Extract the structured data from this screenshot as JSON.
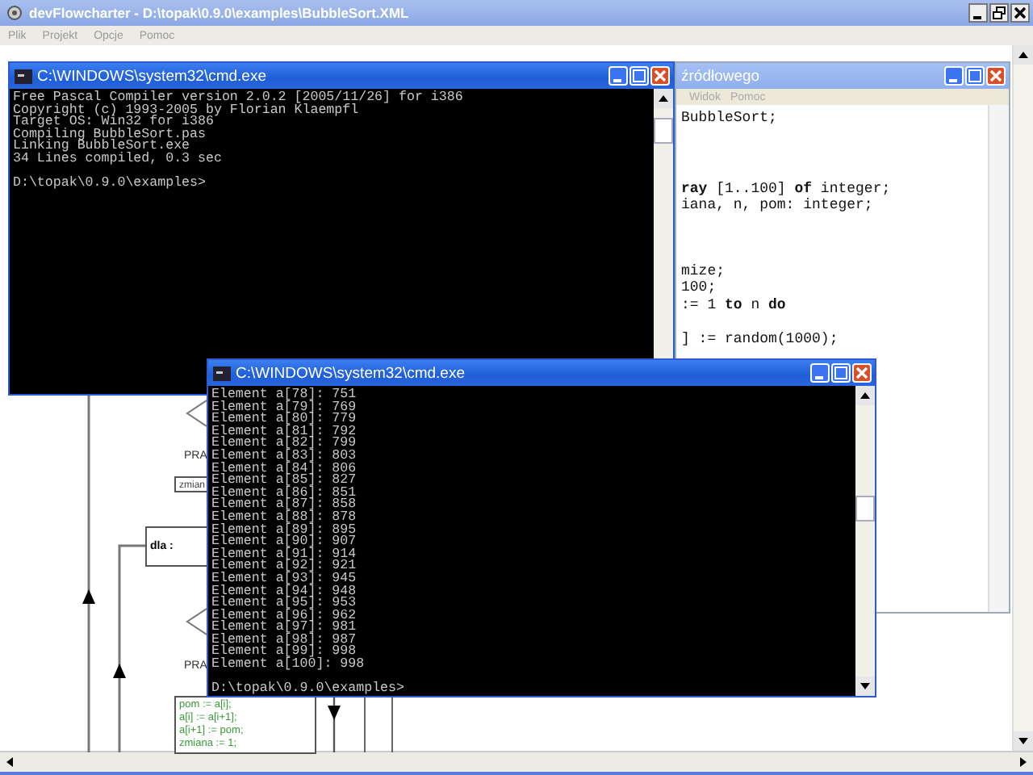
{
  "main_window": {
    "title": "devFlowcharter - D:\\topak\\0.9.0\\examples\\BubbleSort.XML",
    "menu": [
      "Plik",
      "Projekt",
      "Opcje",
      "Pomoc"
    ]
  },
  "flowchart": {
    "nodes": [
      {
        "kind": "label",
        "text": "PRA"
      },
      {
        "kind": "process",
        "text": "zmian"
      },
      {
        "kind": "loop",
        "text": "dla :"
      },
      {
        "kind": "label",
        "text": "PRA"
      },
      {
        "kind": "code_box",
        "lines": [
          "pom := a[i];",
          "a[i] := a[i+1];",
          "a[i+1] := pom;",
          "zmiana := 1;"
        ]
      }
    ]
  },
  "editor_window": {
    "title": "źródłowego",
    "menu": [
      "Widok",
      "Pomoc"
    ],
    "blocks": [
      [
        "BubbleSort;"
      ],
      [
        "**ray** [1..100] **of** integer;",
        "iana, n, pom: integer;"
      ],
      [
        "mize;",
        "100;",
        ":= 1 **to** n **do**"
      ],
      [
        "] := random(1000);"
      ]
    ]
  },
  "consoles": [
    {
      "title": "C:\\WINDOWS\\system32\\cmd.exe",
      "output": [
        "Free Pascal Compiler version 2.0.2 [2005/11/26] for i386",
        "Copyright (c) 1993-2005 by Florian Klaempfl",
        "Target OS: Win32 for i386",
        "Compiling BubbleSort.pas",
        "Linking BubbleSort.exe",
        "34 Lines compiled, 0.3 sec"
      ],
      "prompt": "D:\\topak\\0.9.0\\examples>"
    },
    {
      "title": "C:\\WINDOWS\\system32\\cmd.exe",
      "output": [
        "Element a[78]: 751",
        "Element a[79]: 769",
        "Element a[80]: 779",
        "Element a[81]: 792",
        "Element a[82]: 799",
        "Element a[83]: 803",
        "Element a[84]: 806",
        "Element a[85]: 827",
        "Element a[86]: 851",
        "Element a[87]: 858",
        "Element a[88]: 878",
        "Element a[89]: 895",
        "Element a[90]: 907",
        "Element a[91]: 914",
        "Element a[92]: 921",
        "Element a[93]: 945",
        "Element a[94]: 948",
        "Element a[95]: 953",
        "Element a[96]: 962",
        "Element a[97]: 981",
        "Element a[98]: 987",
        "Element a[99]: 998",
        "Element a[100]: 998"
      ],
      "prompt": "D:\\topak\\0.9.0\\examples>"
    }
  ]
}
